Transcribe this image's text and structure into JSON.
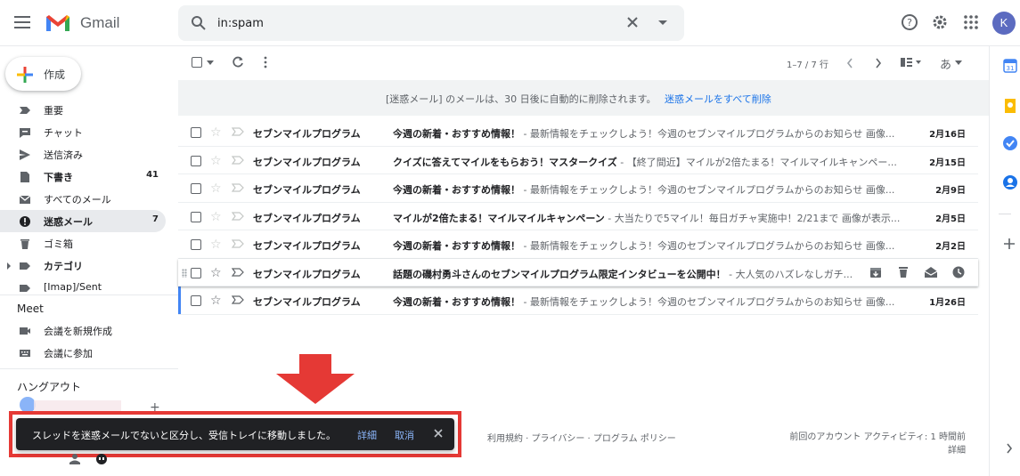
{
  "header": {
    "app_name": "Gmail",
    "search_value": "in:spam",
    "avatar_letter": "K"
  },
  "sidebar": {
    "compose_label": "作成",
    "items": [
      {
        "label": "重要",
        "count": "",
        "icon": "label-important-icon",
        "bold": false
      },
      {
        "label": "チャット",
        "count": "",
        "icon": "chat-icon",
        "bold": false
      },
      {
        "label": "送信済み",
        "count": "",
        "icon": "send-icon",
        "bold": false
      },
      {
        "label": "下書き",
        "count": "41",
        "icon": "draft-icon",
        "bold": true
      },
      {
        "label": "すべてのメール",
        "count": "",
        "icon": "mail-icon",
        "bold": false
      },
      {
        "label": "迷惑メール",
        "count": "7",
        "icon": "spam-icon",
        "bold": true
      },
      {
        "label": "ゴミ箱",
        "count": "",
        "icon": "trash-icon",
        "bold": false
      },
      {
        "label": "カテゴリ",
        "count": "",
        "icon": "label-icon",
        "bold": true
      },
      {
        "label": "[Imap]/Sent",
        "count": "",
        "icon": "label-icon",
        "bold": false
      }
    ],
    "meet_heading": "Meet",
    "meet_items": [
      {
        "label": "会議を新規作成",
        "icon": "video-icon"
      },
      {
        "label": "会議に参加",
        "icon": "keyboard-icon"
      }
    ],
    "hangouts_heading": "ハングアウト"
  },
  "toolbar": {
    "pager": "1–7 / 7 行",
    "input_tool_label": "あ"
  },
  "banner": {
    "text": "[迷惑メール] のメールは、30 日後に自動的に削除されます。",
    "link": "迷惑メールをすべて削除"
  },
  "emails": [
    {
      "sender": "セブンマイルプログラム",
      "subject": "今週の新着・おすすめ情報！",
      "snippet": " - 最新情報をチェックしよう！今週のセブンマイルプログラムからのお知らせ 画像...",
      "date": "2月16日"
    },
    {
      "sender": "セブンマイルプログラム",
      "subject": "クイズに答えてマイルをもらおう！マスタークイズ",
      "snippet": " - 【終了間近】マイルが2倍たまる！マイルマイルキャンペー...",
      "date": "2月15日"
    },
    {
      "sender": "セブンマイルプログラム",
      "subject": "今週の新着・おすすめ情報！",
      "snippet": " - 最新情報をチェックしよう！今週のセブンマイルプログラムからのお知らせ 画像...",
      "date": "2月9日"
    },
    {
      "sender": "セブンマイルプログラム",
      "subject": "マイルが2倍たまる！マイルマイルキャンペーン",
      "snippet": " - 大当たりで5マイル！毎日ガチャ実施中！2/21まで 画像が表示...",
      "date": "2月5日"
    },
    {
      "sender": "セブンマイルプログラム",
      "subject": "今週の新着・おすすめ情報！",
      "snippet": " - 最新情報をチェックしよう！今週のセブンマイルプログラムからのお知らせ 画像...",
      "date": "2月2日"
    },
    {
      "sender": "セブンマイルプログラム",
      "subject": "話題の磯村勇斗さんのセブンマイルプログラム限定インタビューを公開中！",
      "snippet": " - 大人気のハズレなしガチ...",
      "date": ""
    },
    {
      "sender": "セブンマイルプログラム",
      "subject": "今週の新着・おすすめ情報！",
      "snippet": " - 最新情報をチェックしよう！今週のセブンマイルプログラムからのお知らせ 画像...",
      "date": "1月26日"
    }
  ],
  "footer": {
    "links": "利用規約 · プライバシー · プログラム ポリシー",
    "activity": "前回のアカウント アクティビティ: 1 時間前",
    "detail": "詳細"
  },
  "snackbar": {
    "message": "スレッドを迷惑メールでないと区分し、受信トレイに移動しました。",
    "detail": "詳細",
    "undo": "取消"
  },
  "colors": {
    "annotation_red": "#e53935",
    "link_blue": "#1a73e8",
    "snackbar_bg": "#202124"
  }
}
